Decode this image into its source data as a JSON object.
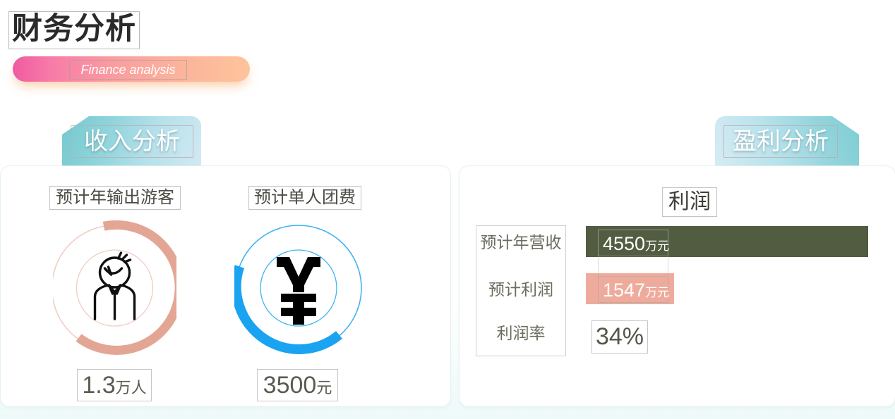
{
  "header": {
    "title": "财务分析",
    "subtitle": "Finance analysis"
  },
  "tabs": [
    {
      "id": "income",
      "label": "收入分析"
    },
    {
      "id": "profit",
      "label": "盈利分析"
    }
  ],
  "income_card": {
    "metrics": [
      {
        "title": "预计年输出游客",
        "value_number": "1.3",
        "value_unit": "万人",
        "icon": "person-icon",
        "ring_color": "#e3a695",
        "ring_track_color": "#f0cdc4",
        "arc_fraction": 0.72
      },
      {
        "title": "预计单人团费",
        "value_number": "3500",
        "value_unit": "元",
        "icon": "yen-icon",
        "ring_color": "#1aa3f0",
        "ring_track_color": "#3fb2f2",
        "arc_fraction": 0.55
      }
    ]
  },
  "profit_card": {
    "heading": "利润",
    "rows": [
      {
        "label": "预计年营收",
        "value_number": "4550",
        "value_unit": "万元",
        "bar_color": "#525c41",
        "bar_ratio": 1.0
      },
      {
        "label": "预计利润",
        "value_number": "1547",
        "value_unit": "万元",
        "bar_color": "#eeab9c",
        "bar_ratio": 0.34
      },
      {
        "label": "利润率",
        "value_text": "34%"
      }
    ]
  },
  "colors": {
    "accent_pink": "#ef5ba1",
    "accent_peach": "#fdc49b",
    "tab_teal": "#74c9cf",
    "tab_blue": "#d2e9f3",
    "bar_olive": "#525c41",
    "bar_salmon": "#eeab9c",
    "page_background": "#ffffff"
  }
}
